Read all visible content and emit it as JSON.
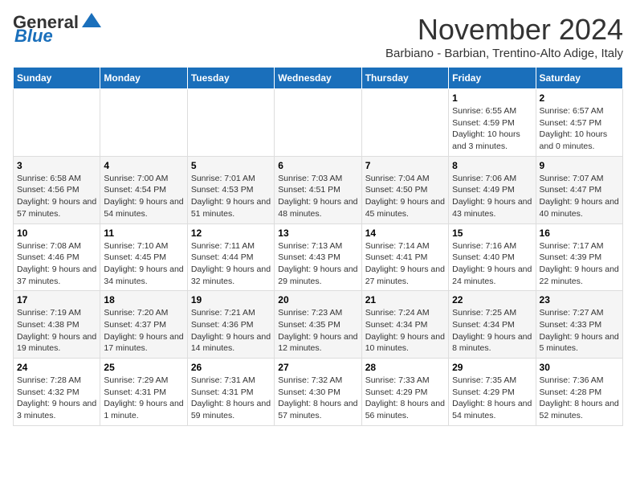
{
  "logo": {
    "part1": "General",
    "part2": "Blue"
  },
  "title": "November 2024",
  "subtitle": "Barbiano - Barbian, Trentino-Alto Adige, Italy",
  "daylight_label": "Daylight hours",
  "days_of_week": [
    "Sunday",
    "Monday",
    "Tuesday",
    "Wednesday",
    "Thursday",
    "Friday",
    "Saturday"
  ],
  "weeks": [
    {
      "row_alt": false,
      "days": [
        {
          "num": "",
          "info": ""
        },
        {
          "num": "",
          "info": ""
        },
        {
          "num": "",
          "info": ""
        },
        {
          "num": "",
          "info": ""
        },
        {
          "num": "",
          "info": ""
        },
        {
          "num": "1",
          "info": "Sunrise: 6:55 AM\nSunset: 4:59 PM\nDaylight: 10 hours and 3 minutes."
        },
        {
          "num": "2",
          "info": "Sunrise: 6:57 AM\nSunset: 4:57 PM\nDaylight: 10 hours and 0 minutes."
        }
      ]
    },
    {
      "row_alt": true,
      "days": [
        {
          "num": "3",
          "info": "Sunrise: 6:58 AM\nSunset: 4:56 PM\nDaylight: 9 hours and 57 minutes."
        },
        {
          "num": "4",
          "info": "Sunrise: 7:00 AM\nSunset: 4:54 PM\nDaylight: 9 hours and 54 minutes."
        },
        {
          "num": "5",
          "info": "Sunrise: 7:01 AM\nSunset: 4:53 PM\nDaylight: 9 hours and 51 minutes."
        },
        {
          "num": "6",
          "info": "Sunrise: 7:03 AM\nSunset: 4:51 PM\nDaylight: 9 hours and 48 minutes."
        },
        {
          "num": "7",
          "info": "Sunrise: 7:04 AM\nSunset: 4:50 PM\nDaylight: 9 hours and 45 minutes."
        },
        {
          "num": "8",
          "info": "Sunrise: 7:06 AM\nSunset: 4:49 PM\nDaylight: 9 hours and 43 minutes."
        },
        {
          "num": "9",
          "info": "Sunrise: 7:07 AM\nSunset: 4:47 PM\nDaylight: 9 hours and 40 minutes."
        }
      ]
    },
    {
      "row_alt": false,
      "days": [
        {
          "num": "10",
          "info": "Sunrise: 7:08 AM\nSunset: 4:46 PM\nDaylight: 9 hours and 37 minutes."
        },
        {
          "num": "11",
          "info": "Sunrise: 7:10 AM\nSunset: 4:45 PM\nDaylight: 9 hours and 34 minutes."
        },
        {
          "num": "12",
          "info": "Sunrise: 7:11 AM\nSunset: 4:44 PM\nDaylight: 9 hours and 32 minutes."
        },
        {
          "num": "13",
          "info": "Sunrise: 7:13 AM\nSunset: 4:43 PM\nDaylight: 9 hours and 29 minutes."
        },
        {
          "num": "14",
          "info": "Sunrise: 7:14 AM\nSunset: 4:41 PM\nDaylight: 9 hours and 27 minutes."
        },
        {
          "num": "15",
          "info": "Sunrise: 7:16 AM\nSunset: 4:40 PM\nDaylight: 9 hours and 24 minutes."
        },
        {
          "num": "16",
          "info": "Sunrise: 7:17 AM\nSunset: 4:39 PM\nDaylight: 9 hours and 22 minutes."
        }
      ]
    },
    {
      "row_alt": true,
      "days": [
        {
          "num": "17",
          "info": "Sunrise: 7:19 AM\nSunset: 4:38 PM\nDaylight: 9 hours and 19 minutes."
        },
        {
          "num": "18",
          "info": "Sunrise: 7:20 AM\nSunset: 4:37 PM\nDaylight: 9 hours and 17 minutes."
        },
        {
          "num": "19",
          "info": "Sunrise: 7:21 AM\nSunset: 4:36 PM\nDaylight: 9 hours and 14 minutes."
        },
        {
          "num": "20",
          "info": "Sunrise: 7:23 AM\nSunset: 4:35 PM\nDaylight: 9 hours and 12 minutes."
        },
        {
          "num": "21",
          "info": "Sunrise: 7:24 AM\nSunset: 4:34 PM\nDaylight: 9 hours and 10 minutes."
        },
        {
          "num": "22",
          "info": "Sunrise: 7:25 AM\nSunset: 4:34 PM\nDaylight: 9 hours and 8 minutes."
        },
        {
          "num": "23",
          "info": "Sunrise: 7:27 AM\nSunset: 4:33 PM\nDaylight: 9 hours and 5 minutes."
        }
      ]
    },
    {
      "row_alt": false,
      "days": [
        {
          "num": "24",
          "info": "Sunrise: 7:28 AM\nSunset: 4:32 PM\nDaylight: 9 hours and 3 minutes."
        },
        {
          "num": "25",
          "info": "Sunrise: 7:29 AM\nSunset: 4:31 PM\nDaylight: 9 hours and 1 minute."
        },
        {
          "num": "26",
          "info": "Sunrise: 7:31 AM\nSunset: 4:31 PM\nDaylight: 8 hours and 59 minutes."
        },
        {
          "num": "27",
          "info": "Sunrise: 7:32 AM\nSunset: 4:30 PM\nDaylight: 8 hours and 57 minutes."
        },
        {
          "num": "28",
          "info": "Sunrise: 7:33 AM\nSunset: 4:29 PM\nDaylight: 8 hours and 56 minutes."
        },
        {
          "num": "29",
          "info": "Sunrise: 7:35 AM\nSunset: 4:29 PM\nDaylight: 8 hours and 54 minutes."
        },
        {
          "num": "30",
          "info": "Sunrise: 7:36 AM\nSunset: 4:28 PM\nDaylight: 8 hours and 52 minutes."
        }
      ]
    }
  ]
}
